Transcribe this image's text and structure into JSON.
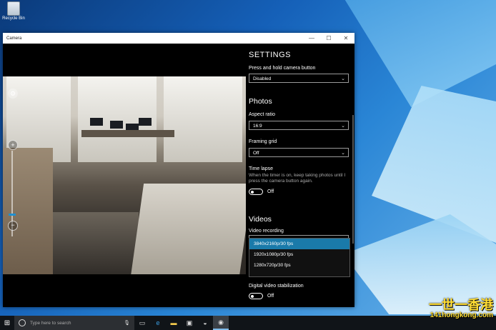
{
  "desktop": {
    "recycle_bin_label": "Recycle Bin"
  },
  "window": {
    "title": "Camera",
    "controls": {
      "minimize": "—",
      "maximize": "☐",
      "close": "✕"
    }
  },
  "viewfinder": {
    "zoom_plus": "+",
    "zoom_minus": "−",
    "settings_icon": "⚙"
  },
  "settings": {
    "heading": "SETTINGS",
    "camera_button_label": "Press and hold camera button",
    "camera_button_value": "Disabled",
    "photos_heading": "Photos",
    "aspect_ratio_label": "Aspect ratio",
    "aspect_ratio_value": "16:9",
    "framing_grid_label": "Framing grid",
    "framing_grid_value": "Off",
    "time_lapse_label": "Time lapse",
    "time_lapse_desc": "When the timer is on, keep taking photos until I press the camera button again.",
    "time_lapse_state": "Off",
    "videos_heading": "Videos",
    "video_recording_label": "Video recording",
    "video_options": [
      "3840x2160p/30 fps",
      "1920x1080p/30 fps",
      "1280x720p/30 fps"
    ],
    "video_selected_index": 0,
    "stabilization_label": "Digital video stabilization",
    "stabilization_state": "Off"
  },
  "taskbar": {
    "search_placeholder": "Type here to search",
    "icons": [
      "task-view-icon",
      "edge-icon",
      "file-explorer-icon",
      "store-icon",
      "photos-icon",
      "camera-icon"
    ]
  },
  "watermark": {
    "line1": "一世一香港",
    "line2": "141hongkong.com"
  },
  "colors": {
    "accent": "#1a7aaa",
    "taskbar": "#101418",
    "watermark": "#ffdd33"
  }
}
